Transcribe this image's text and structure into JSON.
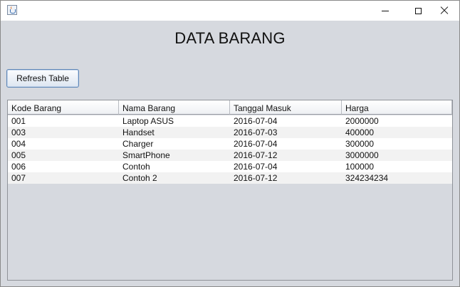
{
  "window": {
    "title": ""
  },
  "heading": "DATA BARANG",
  "toolbar": {
    "refresh_label": "Refresh Table"
  },
  "table": {
    "columns": [
      "Kode Barang",
      "Nama Barang",
      "Tanggal Masuk",
      "Harga"
    ],
    "rows": [
      [
        "001",
        "Laptop ASUS",
        "2016-07-04",
        "2000000"
      ],
      [
        "003",
        "Handset",
        "2016-07-03",
        "400000"
      ],
      [
        "004",
        "Charger",
        "2016-07-04",
        "300000"
      ],
      [
        "005",
        "SmartPhone",
        "2016-07-12",
        "3000000"
      ],
      [
        "006",
        "Contoh",
        "2016-07-04",
        "100000"
      ],
      [
        "007",
        "Contoh 2",
        "2016-07-12",
        "324234234"
      ]
    ]
  }
}
